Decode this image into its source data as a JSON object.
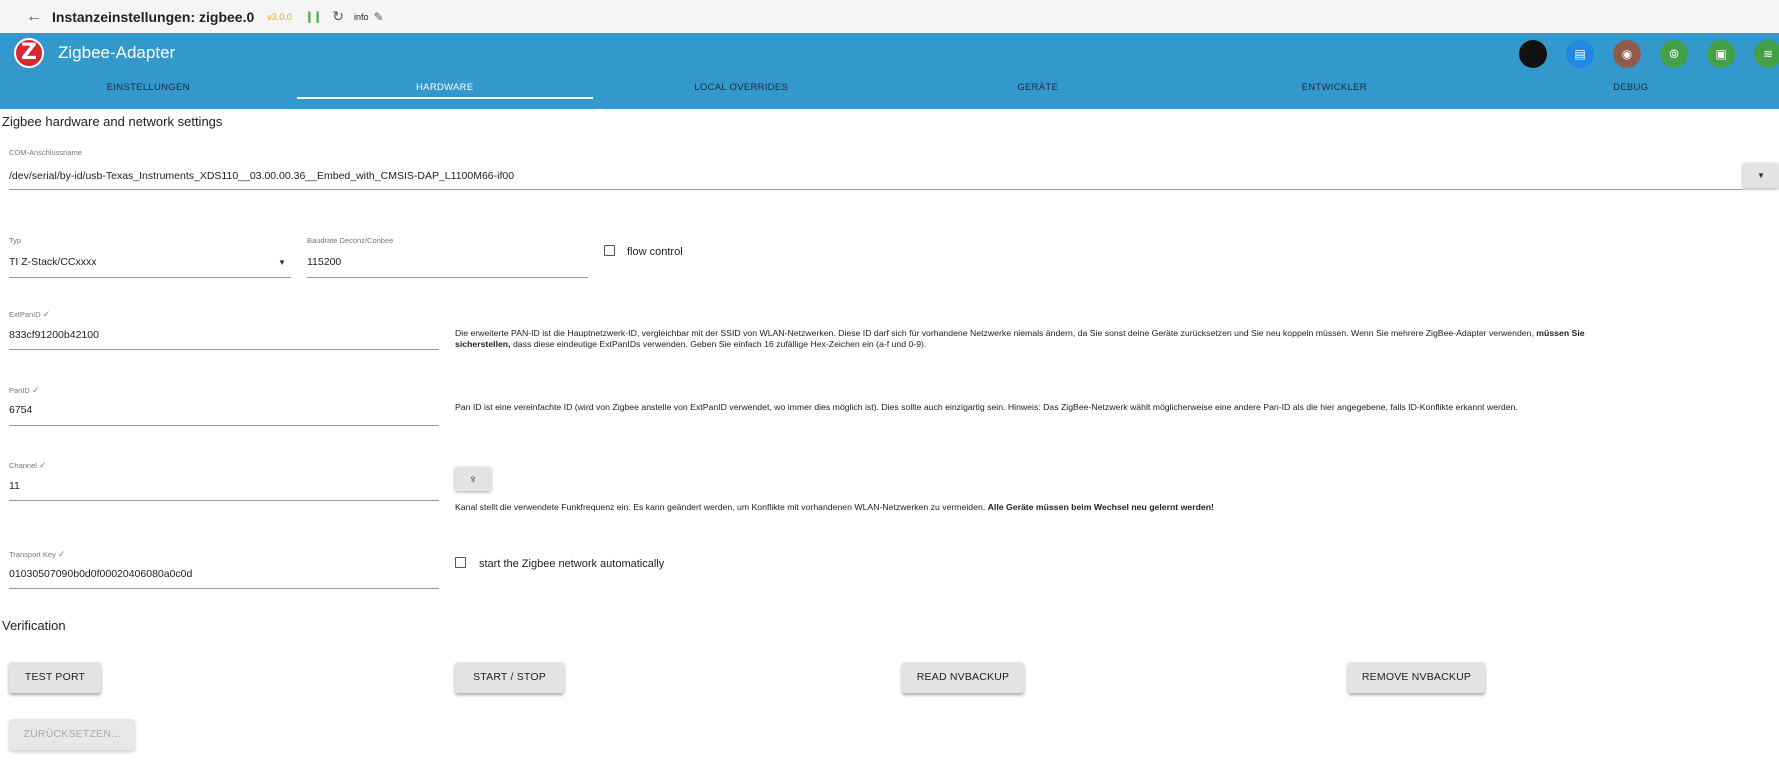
{
  "topbar": {
    "back_icon": "arrow-left-icon",
    "title": "Instanzeinstellungen: zigbee.0",
    "version": "v3.0.0",
    "log_level": "info",
    "version_color": "#f0a030",
    "status_color": "#4caf50"
  },
  "app": {
    "title": "Zigbee-Adapter",
    "logo_letter": "Z",
    "brand_color": "#3399cc",
    "logo_color": "#d9262f",
    "header_icons": [
      {
        "name": "dark-circle-icon",
        "color": "#111111"
      },
      {
        "name": "device-icon",
        "color": "#1e88e5"
      },
      {
        "name": "smart-plug-icon",
        "color": "#8d5c4a"
      },
      {
        "name": "signal-icon",
        "color": "#43a047"
      },
      {
        "name": "chip-icon",
        "color": "#43a047"
      },
      {
        "name": "antenna-icon",
        "color": "#43a047"
      }
    ]
  },
  "tabs": [
    {
      "label": "Einstellungen"
    },
    {
      "label": "Hardware"
    },
    {
      "label": "Local Overrides"
    },
    {
      "label": "Geräte"
    },
    {
      "label": "Entwickler"
    },
    {
      "label": "Debug"
    }
  ],
  "form": {
    "section_title": "Zigbee hardware and network settings",
    "com_port": {
      "label": "COM-Anschlussname",
      "value": "/dev/serial/by-id/usb-Texas_Instruments_XDS110__03.00.00.36__Embed_with_CMSIS-DAP_L1100M66-if00"
    },
    "type": {
      "label": "Typ",
      "value": "TI Z-Stack/CCxxxx"
    },
    "baudrate": {
      "label": "Baudrate Deconz/Conbee",
      "value": "115200"
    },
    "flow_control": {
      "label": "flow control",
      "checked": false
    },
    "extpanid": {
      "label": "ExtPanID",
      "value": "833cf91200b42100",
      "desc_1": "Die erweiterte PAN-ID ist die Hauptnetzwerk-ID, vergleichbar mit der SSID von WLAN-Netzwerken. Diese ID darf sich für vorhandene Netzwerke niemals ändern, da Sie sonst deine Geräte zurücksetzen und Sie neu koppeln müssen. Wenn Sie mehrere ZigBee-Adapter verwenden, ",
      "desc_bold": "müssen Sie sicherstellen,",
      "desc_2": " dass diese eindeutige ExtPanIDs verwenden. Geben Sie einfach 16 zufällige Hex-Zeichen ein (a-f und 0-9)."
    },
    "panid": {
      "label": "PanID",
      "value": "6754",
      "desc": "Pan ID ist eine vereinfachte ID (wird von Zigbee anstelle von ExtPanID verwendet, wo immer dies möglich ist). Dies sollte auch einzigartig sein. Hinweis: Das ZigBee-Netzwerk wählt möglicherweise eine andere Pan-ID als die hier angegebene, falls ID-Konflikte erkannt werden."
    },
    "channel": {
      "label": "Channel",
      "value": "11",
      "desc_1": "Kanal stellt die verwendete Funkfrequenz ein. Es kann geändert werden, um Konflikte mit vorhandenen WLAN-Netzwerken zu vermeiden. ",
      "desc_bold": "Alle Geräte müssen beim Wechsel neu gelernt werden!"
    },
    "transport_key": {
      "label": "Transport Key",
      "value": "01030507090b0d0f00020406080a0c0d"
    },
    "autostart": {
      "label": "start the Zigbee network automatically",
      "checked": false
    }
  },
  "verification": {
    "title": "Verification",
    "buttons": {
      "test_port": "TEST PORT",
      "start_stop": "START / STOP",
      "read_nvbackup": "READ NVBACKUP",
      "remove_nvbackup": "REMOVE NVBACKUP",
      "reset": "ZURÜCKSETZEN..."
    }
  }
}
